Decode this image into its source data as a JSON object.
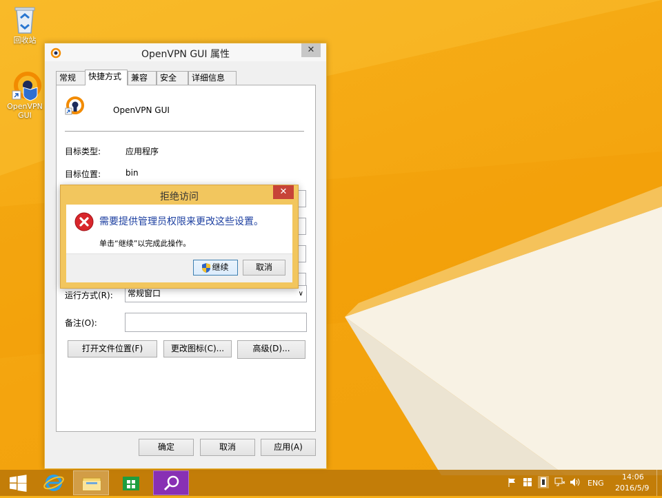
{
  "desktop": {
    "recycle_bin": "回收站",
    "openvpn_line1": "OpenVPN",
    "openvpn_line2": "GUI"
  },
  "props_window": {
    "title": "OpenVPN GUI 属性",
    "close": "✕",
    "tabs": [
      "常规",
      "快捷方式",
      "兼容性",
      "安全",
      "详细信息"
    ],
    "app_name": "OpenVPN GUI",
    "target_type_label": "目标类型:",
    "target_type_value": "应用程序",
    "target_location_label": "目标位置:",
    "target_location_value": "bin",
    "run_label": "运行方式(R):",
    "run_value": "常规窗口",
    "comment_label": "备注(O):",
    "comment_value": "",
    "btn_open_location": "打开文件位置(F)",
    "btn_change_icon": "更改图标(C)...",
    "btn_advanced": "高级(D)...",
    "btn_ok": "确定",
    "btn_cancel": "取消",
    "btn_apply": "应用(A)"
  },
  "dialog": {
    "title": "拒绝访问",
    "close": "✕",
    "message": "需要提供管理员权限来更改这些设置。",
    "sub": "单击“继续”以完成此操作。",
    "btn_continue": "继续",
    "btn_cancel": "取消"
  },
  "taskbar": {
    "lang": "ENG",
    "time": "14:06",
    "date": "2016/5/9"
  }
}
